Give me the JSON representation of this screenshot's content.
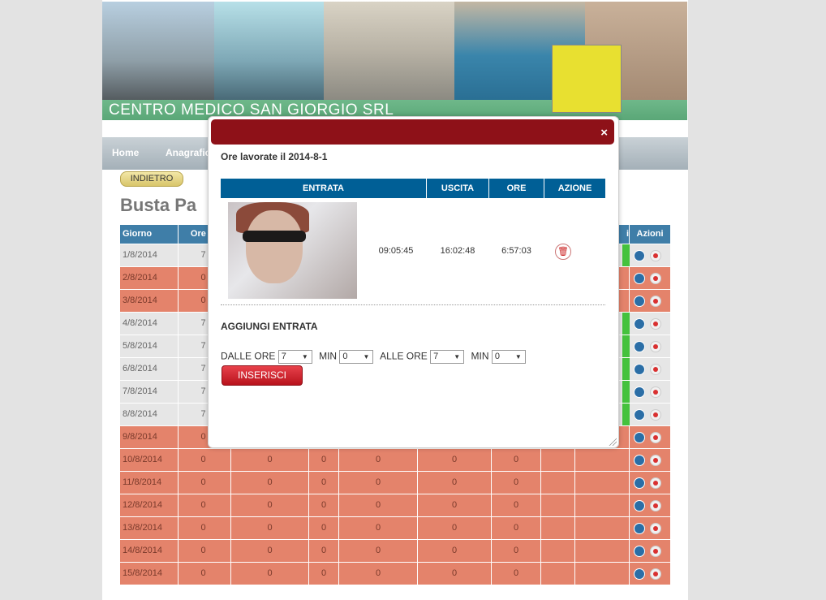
{
  "banner": {
    "brand": "CENTRO MEDICO SAN GIORGIO SRL"
  },
  "nav": {
    "items": [
      "Home",
      "Anagrafic"
    ]
  },
  "back_label": "INDIETRO",
  "page_title": "Busta Pa",
  "table": {
    "headers": [
      "Giorno",
      "Ore M",
      "",
      "",
      "",
      "",
      "",
      "",
      "i",
      "Azioni"
    ],
    "rows": [
      {
        "day": "1/8/2014",
        "a": "7",
        "type": "grey",
        "green": true
      },
      {
        "day": "2/8/2014",
        "a": "0",
        "type": "pink",
        "green": false
      },
      {
        "day": "3/8/2014",
        "a": "0",
        "type": "pink",
        "green": false
      },
      {
        "day": "4/8/2014",
        "a": "7",
        "type": "grey",
        "green": true
      },
      {
        "day": "5/8/2014",
        "a": "7",
        "type": "grey",
        "green": true
      },
      {
        "day": "6/8/2014",
        "a": "7",
        "type": "grey",
        "green": true
      },
      {
        "day": "7/8/2014",
        "a": "7",
        "type": "grey",
        "green": true
      },
      {
        "day": "8/8/2014",
        "a": "7",
        "type": "grey",
        "green": true
      },
      {
        "day": "9/8/2014",
        "a": "0",
        "type": "pink",
        "green": false
      },
      {
        "day": "10/8/2014",
        "a": "0",
        "type": "pink",
        "green": false
      },
      {
        "day": "11/8/2014",
        "a": "0",
        "type": "pink",
        "green": false
      },
      {
        "day": "12/8/2014",
        "a": "0",
        "type": "pink",
        "green": false
      },
      {
        "day": "13/8/2014",
        "a": "0",
        "type": "pink",
        "green": false
      },
      {
        "day": "14/8/2014",
        "a": "0",
        "type": "pink",
        "green": false
      },
      {
        "day": "15/8/2014",
        "a": "0",
        "type": "pink",
        "green": false
      }
    ],
    "zero": "0"
  },
  "modal": {
    "close": "×",
    "subtitle": "Ore lavorate il 2014-8-1",
    "headers": {
      "entrata": "ENTRATA",
      "uscita": "USCITA",
      "ore": "ORE",
      "azione": "AZIONE"
    },
    "entry": {
      "in": "09:05:45",
      "out": "16:02:48",
      "hours": "6:57:03"
    },
    "add_title": "AGGIUNGI ENTRATA",
    "form": {
      "dalle": "DALLE",
      "ore": "ORE",
      "min": "MIN",
      "alle": "ALLE",
      "dalle_ore": "7",
      "dalle_min": "0",
      "alle_ore": "7",
      "alle_min": "0"
    },
    "insert_label": "INSERISCI"
  }
}
